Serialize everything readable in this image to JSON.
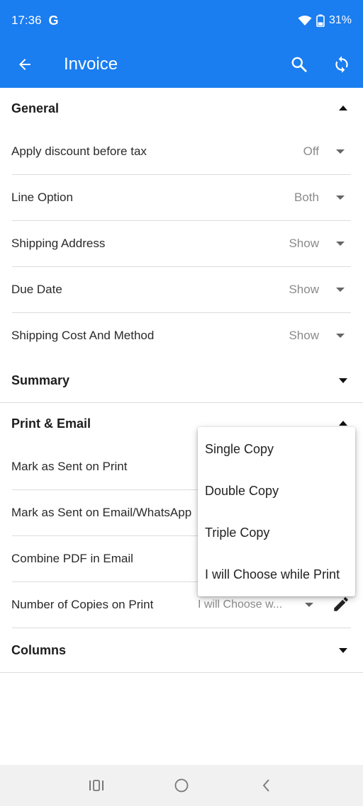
{
  "status_bar": {
    "time": "17:36",
    "g_label": "G",
    "battery": "31%"
  },
  "app_bar": {
    "title": "Invoice",
    "icons": [
      "back-arrow-icon",
      "search-icon",
      "sync-icon"
    ]
  },
  "sections": {
    "general": {
      "title": "General",
      "rows": [
        {
          "label": "Apply discount before tax",
          "value": "Off"
        },
        {
          "label": "Line Option",
          "value": "Both"
        },
        {
          "label": "Shipping Address",
          "value": "Show"
        },
        {
          "label": "Due Date",
          "value": "Show"
        },
        {
          "label": "Shipping Cost And Method",
          "value": "Show"
        }
      ]
    },
    "summary": {
      "title": "Summary"
    },
    "print_email": {
      "title": "Print & Email",
      "rows": [
        {
          "label": "Mark as Sent on Print"
        },
        {
          "label": "Mark as Sent on Email/WhatsApp"
        },
        {
          "label": "Combine PDF in Email"
        },
        {
          "label": "Number of Copies on Print",
          "value": "I will Choose w..."
        }
      ]
    },
    "columns": {
      "title": "Columns"
    }
  },
  "dropdown_menu": {
    "options": [
      "Single Copy",
      "Double Copy",
      "Triple Copy",
      "I will Choose while Print"
    ]
  },
  "colors": {
    "primary": "#1a7df0",
    "value_text": "#8a8a8a",
    "divider": "#dcdcdc"
  }
}
